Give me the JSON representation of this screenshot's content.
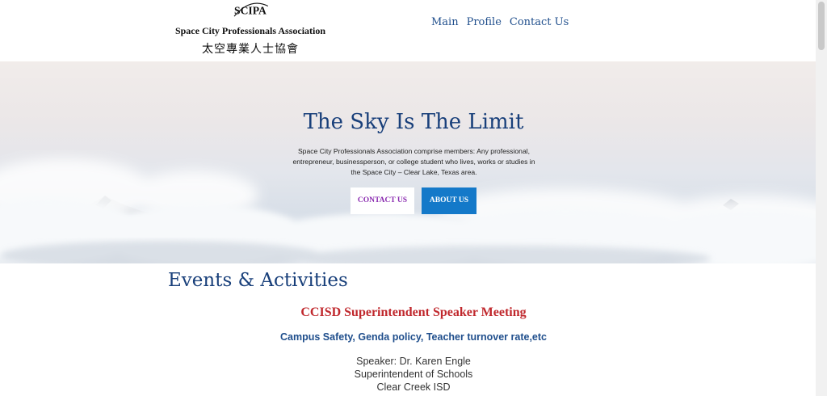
{
  "header": {
    "logo": {
      "mark_text": "SCIPA",
      "name": "Space City Professionals Association",
      "chinese_name": "太空專業人士協會"
    },
    "nav": [
      {
        "label": "Main"
      },
      {
        "label": "Profile"
      },
      {
        "label": "Contact Us"
      }
    ]
  },
  "hero": {
    "title": "The Sky Is The Limit",
    "description": "Space City Professionals Association comprise members: Any professional, entrepreneur, businessperson, or college student who lives, works or studies in the Space City – Clear Lake, Texas area.",
    "buttons": {
      "contact_label": "CONTACT US",
      "about_label": "ABOUT US"
    }
  },
  "events": {
    "heading": "Events & Activities",
    "title": "CCISD Superintendent Speaker Meeting",
    "topics": "Campus Safety, Genda policy, Teacher turnover rate,etc",
    "speaker_lines": [
      "Speaker: Dr. Karen Engle",
      "Superintendent of Schools",
      "Clear Creek ISD"
    ]
  },
  "colors": {
    "brand_blue": "#183f7a",
    "nav_link": "#1f4e8c",
    "event_red": "#c0282d",
    "button_blue": "#1479c9",
    "contact_text": "#8a2bb0"
  }
}
